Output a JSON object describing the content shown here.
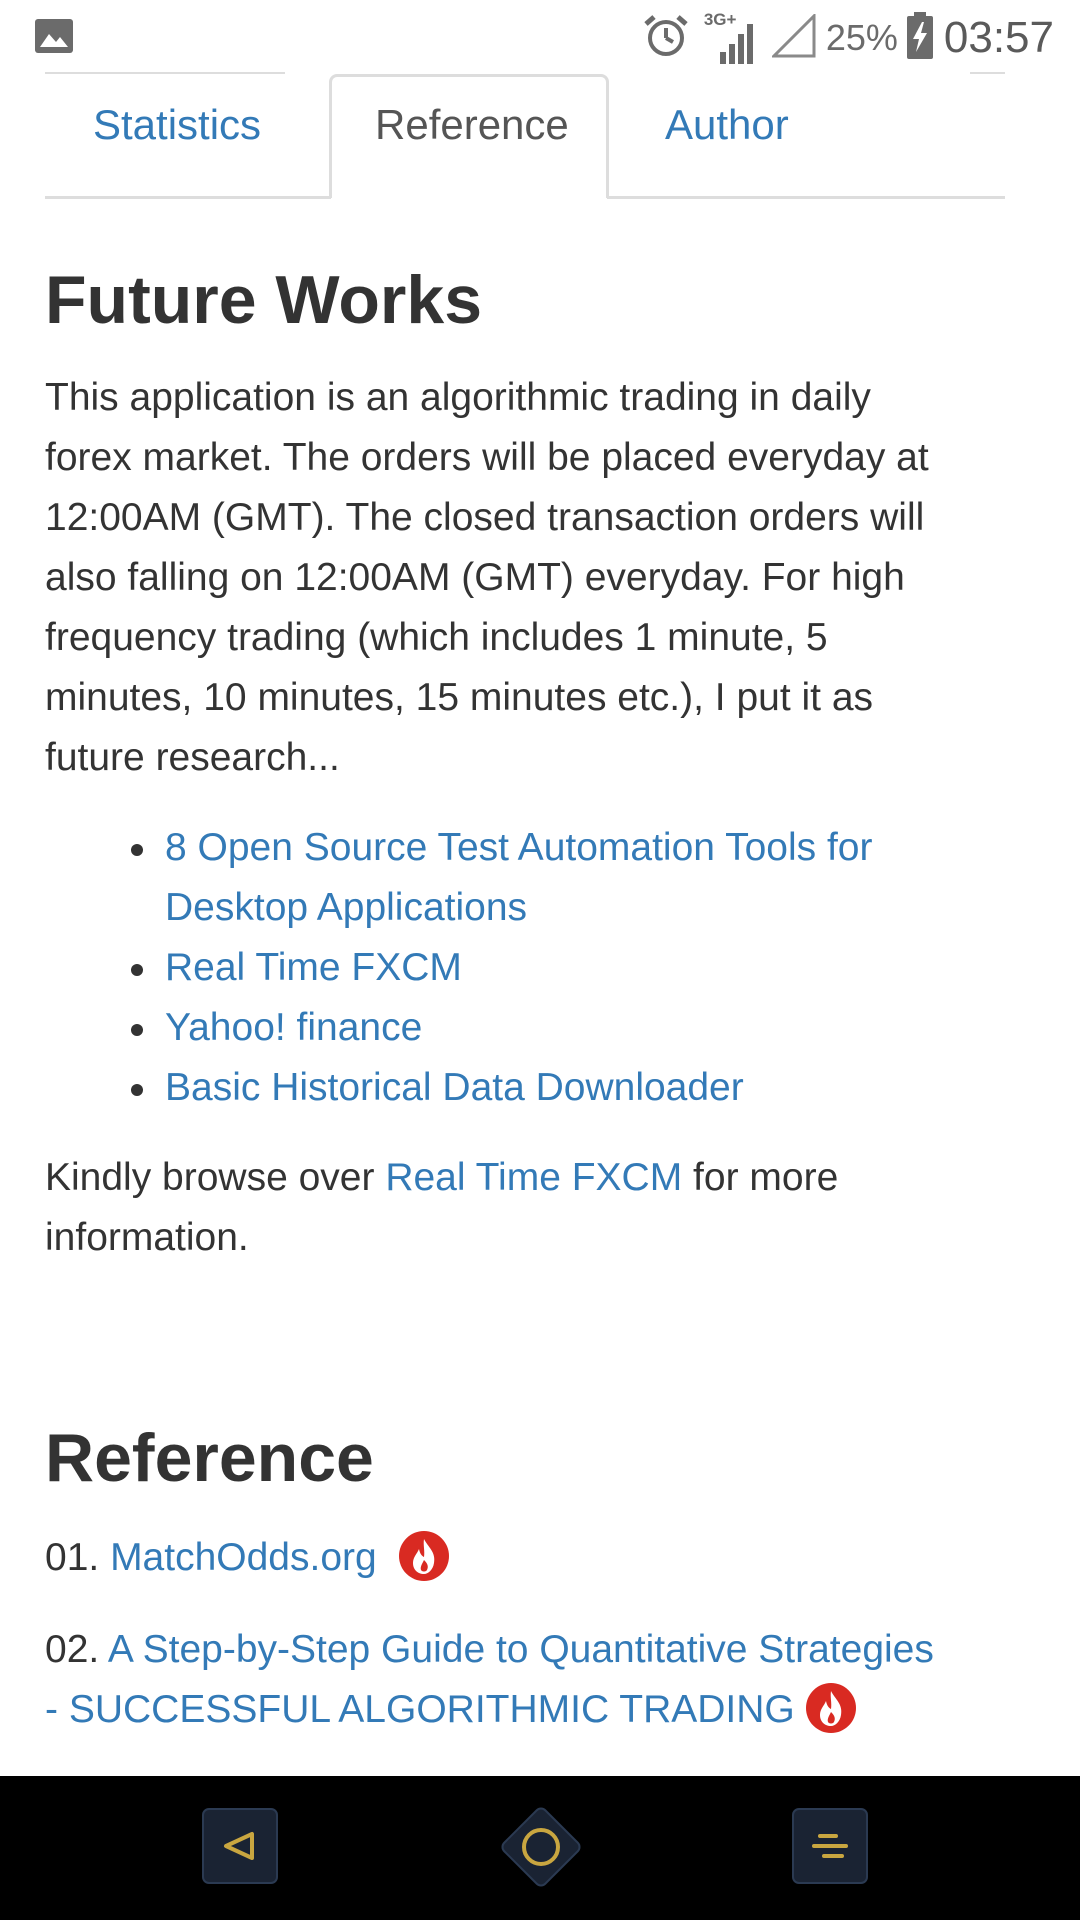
{
  "status_bar": {
    "network": "3G+",
    "battery_percent": "25%",
    "time": "03:57",
    "icons": [
      "image-icon",
      "alarm-icon",
      "signal-icon",
      "signal-empty-icon",
      "battery-charging-icon"
    ]
  },
  "tabs": [
    {
      "label": "Statistics",
      "active": false
    },
    {
      "label": "Reference",
      "active": true
    },
    {
      "label": "Author",
      "active": false
    }
  ],
  "future_works": {
    "heading": "Future Works",
    "paragraph": [
      "This application is an algorithmic trading in daily",
      "forex market. The orders will be placed everyday at",
      "12:00AM (GMT). The closed transaction orders will",
      "also falling on 12:00AM (GMT) everyday. For high",
      "frequency trading (which includes 1 minute, 5",
      "minutes, 10 minutes, 15 minutes etc.), I put it as",
      "future research..."
    ],
    "links": [
      {
        "lines": [
          "8 Open Source Test Automation Tools for",
          "Desktop Applications"
        ]
      },
      {
        "lines": [
          "Real Time FXCM"
        ]
      },
      {
        "lines": [
          "Yahoo! finance"
        ]
      },
      {
        "lines": [
          "Basic Historical Data Downloader"
        ]
      }
    ],
    "browse": {
      "prefix": "Kindly browse over ",
      "link": "Real Time FXCM",
      "suffix": " for more",
      "line2": "information."
    }
  },
  "reference": {
    "heading": "Reference",
    "items": [
      {
        "number": "01.",
        "lines": [
          "MatchOdds.org"
        ]
      },
      {
        "number": "02.",
        "lines": [
          "A Step-by-Step Guide to Quantitative Strategies",
          "- SUCCESSFUL ALGORITHMIC TRADING"
        ]
      }
    ]
  },
  "nav_bar": {
    "buttons": [
      "back-button",
      "home-button",
      "recent-apps-button"
    ],
    "accent_color": "#c9a640",
    "button_bg": "#1a2333"
  },
  "colors": {
    "link": "#337ab7",
    "text": "#333333",
    "tab_border": "#dddddd"
  }
}
